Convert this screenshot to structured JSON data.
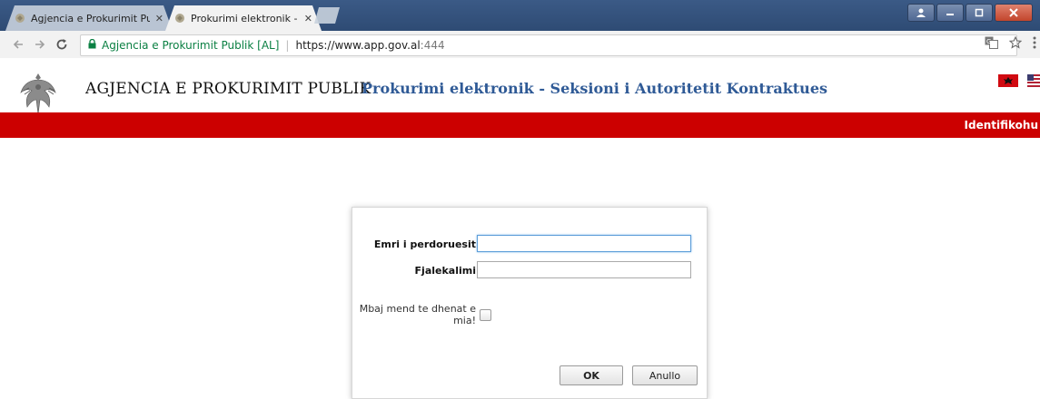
{
  "browser": {
    "tabs": [
      {
        "title": "Agjencia e Prokurimit Pu",
        "active": false
      },
      {
        "title": "Prokurimi elektronik - Se",
        "active": true
      }
    ],
    "tab_close_glyph": "✕",
    "address": {
      "secure_label": "Agjencia e Prokurimit Publik [AL]",
      "url_host": "https://www.app.gov.al",
      "url_port": ":444"
    }
  },
  "header": {
    "agency_name": "AGJENCIA E PROKURIMIT PUBLIK",
    "section_title": "Prokurimi elektronik - Seksioni i Autoritetit Kontraktues",
    "identify_link": "Identifikohu"
  },
  "login": {
    "username_label": "Emri i perdoruesit",
    "username_value": "",
    "password_label": "Fjalekalimi",
    "password_value": "",
    "remember_label": "Mbaj mend te dhenat e mia!",
    "remember_checked": false,
    "ok_label": "OK",
    "cancel_label": "Anullo"
  },
  "colors": {
    "red_bar": "#cc0000",
    "section_title": "#2f5a96",
    "secure_green": "#0b8043"
  },
  "icons": {
    "back": "back-arrow-icon",
    "forward": "forward-arrow-icon",
    "reload": "reload-icon",
    "lock": "lock-icon",
    "translate": "translate-icon",
    "bookmark": "star-icon",
    "menu": "kebab-menu-icon"
  }
}
